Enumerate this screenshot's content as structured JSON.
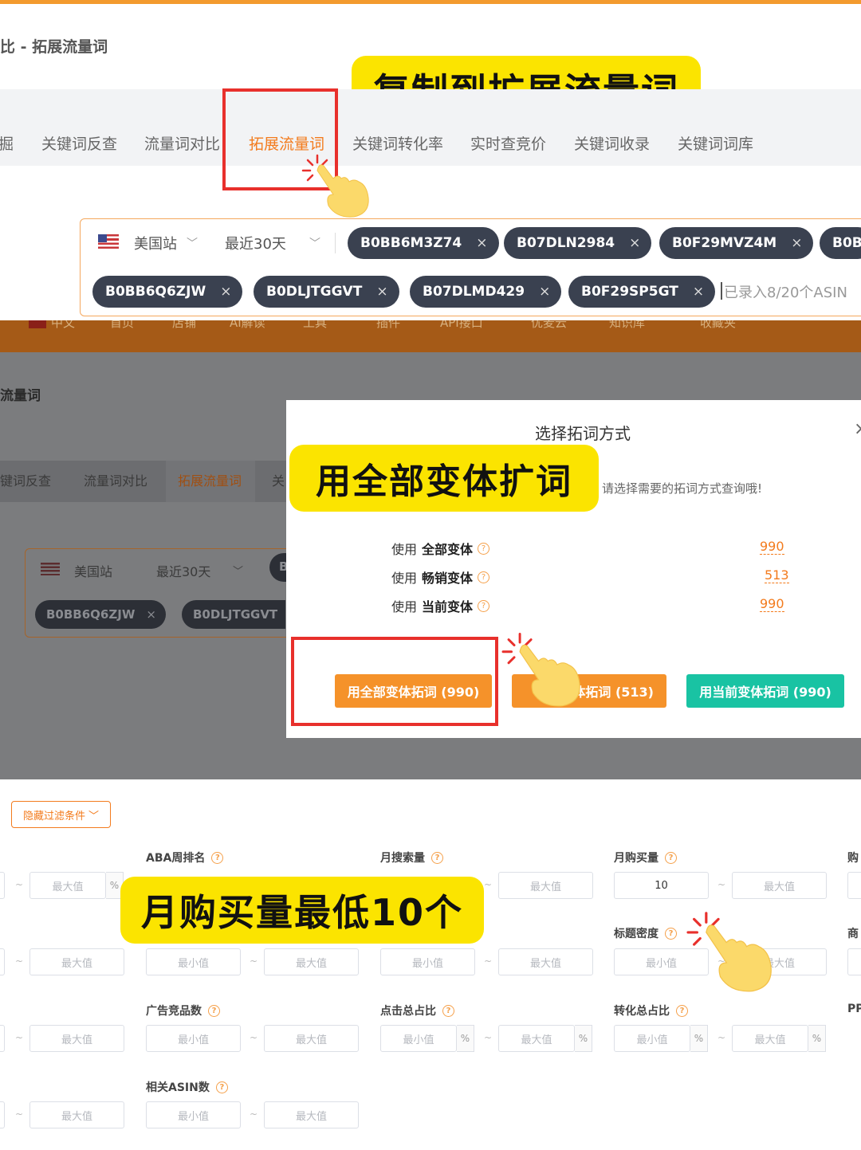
{
  "section1": {
    "page_title": "比 - 拓展流量词",
    "callout": "复制到扩展流量词",
    "tabs": [
      "掘",
      "关键词反查",
      "流量词对比",
      "拓展流量词",
      "关键词转化率",
      "实时查竞价",
      "关键词收录",
      "关键词词库"
    ],
    "site": "美国站",
    "period": "最近30天",
    "asins_row1": [
      "B0BB6M3Z74",
      "B07DLN2984",
      "B0F29MVZ4M",
      "B0B"
    ],
    "asins_row2": [
      "B0BB6Q6ZJW",
      "B0DLJTGGVT",
      "B07DLMD429",
      "B0F29SP5GT"
    ],
    "asin_count": "已录入8/20个ASIN",
    "chip_close": "×"
  },
  "section2": {
    "nav": [
      "中文",
      "首页",
      "店铺",
      "AI解读",
      "工具",
      "插件",
      "API接口",
      "优麦云",
      "知识库",
      "收藏夹"
    ],
    "page_title": "流量词",
    "tabs": [
      "键词反查",
      "流量词对比",
      "拓展流量词",
      "关"
    ],
    "site": "美国站",
    "period": "最近30天",
    "asin_partial": "B",
    "asins": [
      "B0BB6Q6ZJW",
      "B0DLJTGGVT"
    ],
    "modal": {
      "title": "选择拓词方式",
      "close": "×",
      "hint": "请选择需要的拓词方式查询哦!",
      "use": "使用",
      "options": [
        {
          "name": "全部变体",
          "value": "990"
        },
        {
          "name": "畅销变体",
          "value": "513"
        },
        {
          "name": "当前变体",
          "value": "990"
        }
      ],
      "buttons": [
        "用全部变体拓词 (990)",
        "体拓词 (513)",
        "用当前变体拓词 (990)"
      ]
    },
    "callout": "用全部变体扩词"
  },
  "section3": {
    "hide_filters": "隐藏过滤条件",
    "labels": {
      "aba_rank": "ABA周排名",
      "monthly_search": "月搜索量",
      "monthly_purchase": "月购买量",
      "purchase_partial": "购",
      "title_density": "标题密度",
      "product_partial": "商",
      "ad_products": "广告竞品数",
      "click_share": "点击总占比",
      "conversion_share": "转化总占比",
      "pp_partial": "PP",
      "related_asin": "相关ASIN数"
    },
    "min": "最小值",
    "max": "最大值",
    "percent": "%",
    "tilde": "~",
    "monthly_purchase_min": "10",
    "callout": "月购买量最低10个"
  },
  "colors": {
    "accent_orange": "#f37b1d",
    "callout_yellow": "#fbe400",
    "highlight_red": "#e8302c",
    "teal": "#19c3a3"
  },
  "icons": [
    "us-flag-icon",
    "chevron-down-icon",
    "close-icon",
    "help-icon",
    "pointing-hand-icon"
  ]
}
